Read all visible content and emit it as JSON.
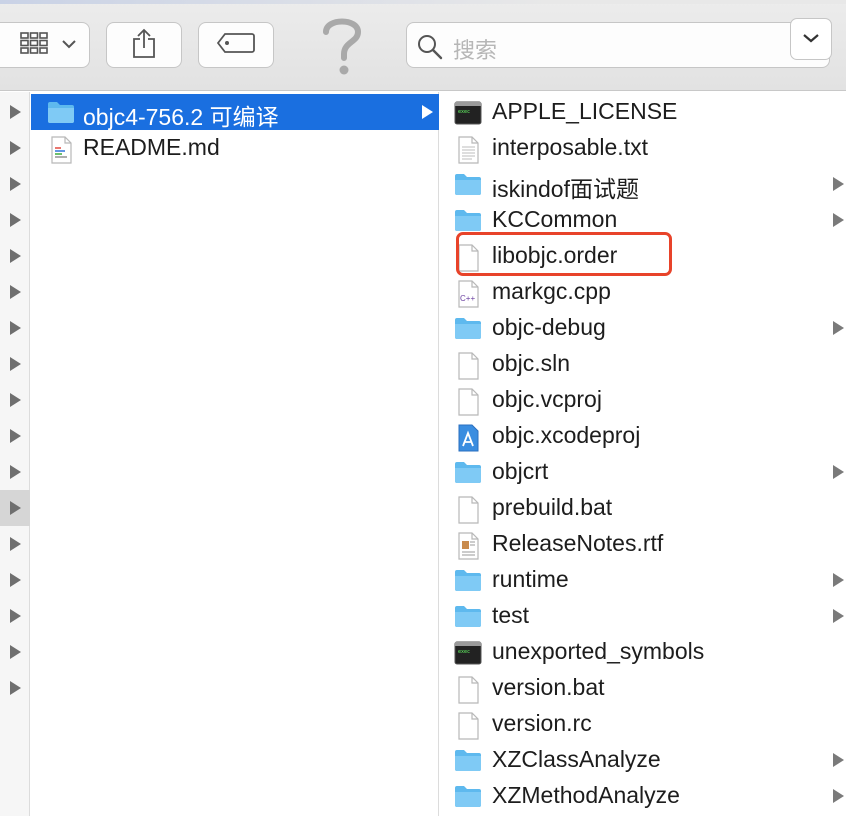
{
  "toolbar": {
    "view_icon": "column-view-icon",
    "share_icon": "share-icon",
    "tag_icon": "tag-icon",
    "help_icon": "help-icon",
    "search_placeholder": "搜索",
    "colors": {
      "bar": "#e4e4e4",
      "button": "#fdfdfd",
      "border": "#c6c6c6"
    }
  },
  "column1": {
    "items": [
      {
        "label": "objc4-756.2 可编译",
        "type": "folder",
        "selected": true,
        "expandable": true
      },
      {
        "label": "README.md",
        "type": "markdown",
        "selected": false,
        "expandable": false
      }
    ]
  },
  "column2": {
    "items": [
      {
        "label": "APPLE_LICENSE",
        "type": "exec",
        "expandable": false
      },
      {
        "label": "interposable.txt",
        "type": "text",
        "expandable": false
      },
      {
        "label": "iskindof面试题",
        "type": "folder",
        "expandable": true
      },
      {
        "label": "KCCommon",
        "type": "folder",
        "expandable": true
      },
      {
        "label": "libobjc.order",
        "type": "blank",
        "expandable": false,
        "highlighted": true
      },
      {
        "label": "markgc.cpp",
        "type": "cpp",
        "expandable": false
      },
      {
        "label": "objc-debug",
        "type": "folder",
        "expandable": true
      },
      {
        "label": "objc.sln",
        "type": "blank",
        "expandable": false
      },
      {
        "label": "objc.vcproj",
        "type": "blank",
        "expandable": false
      },
      {
        "label": "objc.xcodeproj",
        "type": "xcode",
        "expandable": false
      },
      {
        "label": "objcrt",
        "type": "folder",
        "expandable": true
      },
      {
        "label": "prebuild.bat",
        "type": "blank",
        "expandable": false
      },
      {
        "label": "ReleaseNotes.rtf",
        "type": "rtf",
        "expandable": false
      },
      {
        "label": "runtime",
        "type": "folder",
        "expandable": true
      },
      {
        "label": "test",
        "type": "folder",
        "expandable": true
      },
      {
        "label": "unexported_symbols",
        "type": "exec",
        "expandable": false
      },
      {
        "label": "version.bat",
        "type": "blank",
        "expandable": false
      },
      {
        "label": "version.rc",
        "type": "blank",
        "expandable": false
      },
      {
        "label": "XZClassAnalyze",
        "type": "folder",
        "expandable": true
      },
      {
        "label": "XZMethodAnalyze",
        "type": "folder",
        "expandable": true
      }
    ]
  },
  "colors": {
    "selection": "#1a6fe0",
    "highlight_border": "#e8432a",
    "folder": "#6cc2f2"
  }
}
